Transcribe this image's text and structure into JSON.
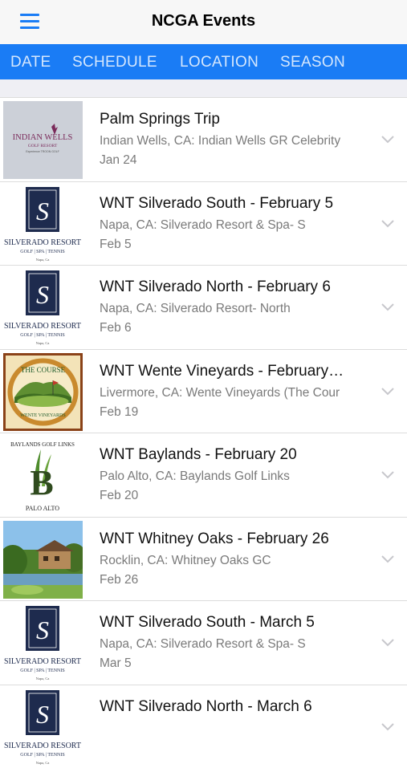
{
  "nav": {
    "title": "NCGA Events",
    "menu_icon": "hamburger-menu-icon"
  },
  "tabs": [
    {
      "label": "DATE"
    },
    {
      "label": "SCHEDULE"
    },
    {
      "label": "LOCATION"
    },
    {
      "label": "SEASON"
    }
  ],
  "logos": {
    "indian_wells": {
      "name": "INDIAN WELLS",
      "sub": "GOLF RESORT",
      "tag": "Experience TROON GOLF"
    },
    "silverado": {
      "name": "SILVERADO RESORT",
      "sub": "GOLF | SPA | TENNIS",
      "city": "Napa, Ca"
    },
    "wente": {
      "top": "THE COURSE",
      "bottom": "WENTE VINEYARDS"
    },
    "baylands": {
      "top": "BAYLANDS GOLF LINKS",
      "bottom": "PALO ALTO",
      "letter": "B"
    }
  },
  "events": [
    {
      "title": "Palm Springs Trip",
      "location": "Indian Wells, CA: Indian Wells GR Celebrity",
      "date": "Jan 24",
      "logo": "indian_wells"
    },
    {
      "title": "WNT Silverado South - February 5",
      "location": "Napa, CA: Silverado Resort & Spa- S",
      "date": "Feb 5",
      "logo": "silverado"
    },
    {
      "title": "WNT Silverado North - February 6",
      "location": "Napa, CA: Silverado Resort- North",
      "date": "Feb 6",
      "logo": "silverado"
    },
    {
      "title": "WNT Wente Vineyards - February…",
      "location": "Livermore, CA: Wente Vineyards (The Cour",
      "date": "Feb 19",
      "logo": "wente"
    },
    {
      "title": "WNT Baylands - February 20",
      "location": "Palo Alto, CA: Baylands Golf Links",
      "date": "Feb 20",
      "logo": "baylands"
    },
    {
      "title": "WNT Whitney Oaks - February 26",
      "location": "Rocklin, CA: Whitney Oaks GC",
      "date": "Feb 26",
      "logo": "whitney_photo"
    },
    {
      "title": "WNT Silverado South - March 5",
      "location": "Napa, CA: Silverado Resort & Spa- S",
      "date": "Mar 5",
      "logo": "silverado"
    },
    {
      "title": "WNT Silverado North - March 6",
      "location": "",
      "date": "",
      "logo": "silverado"
    }
  ]
}
